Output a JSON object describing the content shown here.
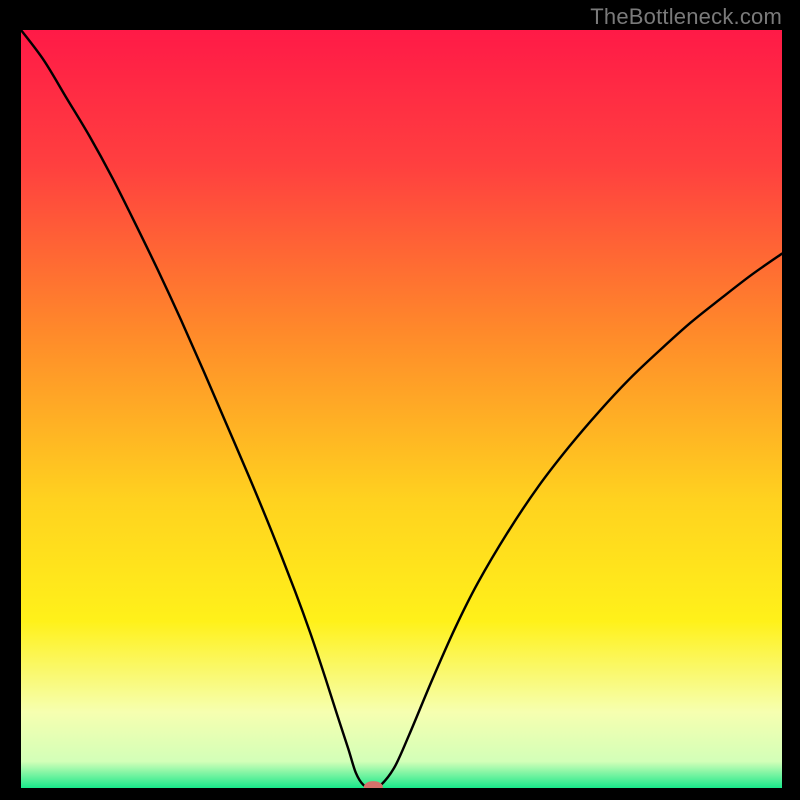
{
  "watermark": "TheBottleneck.com",
  "chart_data": {
    "type": "line",
    "title": "",
    "xlabel": "",
    "ylabel": "",
    "xlim": [
      0,
      100
    ],
    "ylim": [
      0,
      100
    ],
    "grid": false,
    "background_gradient": {
      "direction": "vertical",
      "stops": [
        {
          "pos": 0.0,
          "color": "#ff1a47"
        },
        {
          "pos": 0.18,
          "color": "#ff403f"
        },
        {
          "pos": 0.4,
          "color": "#ff8a2a"
        },
        {
          "pos": 0.62,
          "color": "#ffd21f"
        },
        {
          "pos": 0.78,
          "color": "#fff11a"
        },
        {
          "pos": 0.9,
          "color": "#f6ffb0"
        },
        {
          "pos": 0.965,
          "color": "#d3ffb8"
        },
        {
          "pos": 1.0,
          "color": "#18e88a"
        }
      ]
    },
    "series": [
      {
        "name": "bottleneck-curve",
        "color": "#000000",
        "x": [
          0,
          3,
          6,
          9,
          12,
          15,
          18,
          21,
          24,
          27,
          30,
          33,
          36,
          38,
          40,
          41.5,
          43,
          44,
          45,
          46,
          47,
          49,
          51,
          54,
          57,
          60,
          64,
          68,
          72,
          76,
          80,
          84,
          88,
          92,
          96,
          100
        ],
        "y": [
          100,
          96,
          91,
          86,
          80.5,
          74.5,
          68.3,
          61.8,
          55,
          48,
          41,
          33.7,
          26,
          20.5,
          14.5,
          9.8,
          5.2,
          2.0,
          0.4,
          0.15,
          0.15,
          2.6,
          7.0,
          14.2,
          21.0,
          27.0,
          33.8,
          39.8,
          45.0,
          49.7,
          54.0,
          57.8,
          61.4,
          64.6,
          67.7,
          70.5
        ]
      }
    ],
    "marker": {
      "name": "optimal-point",
      "x": 46.3,
      "y": 0.15,
      "color": "#d6716b",
      "rx": 1.25,
      "ry": 0.75
    }
  }
}
